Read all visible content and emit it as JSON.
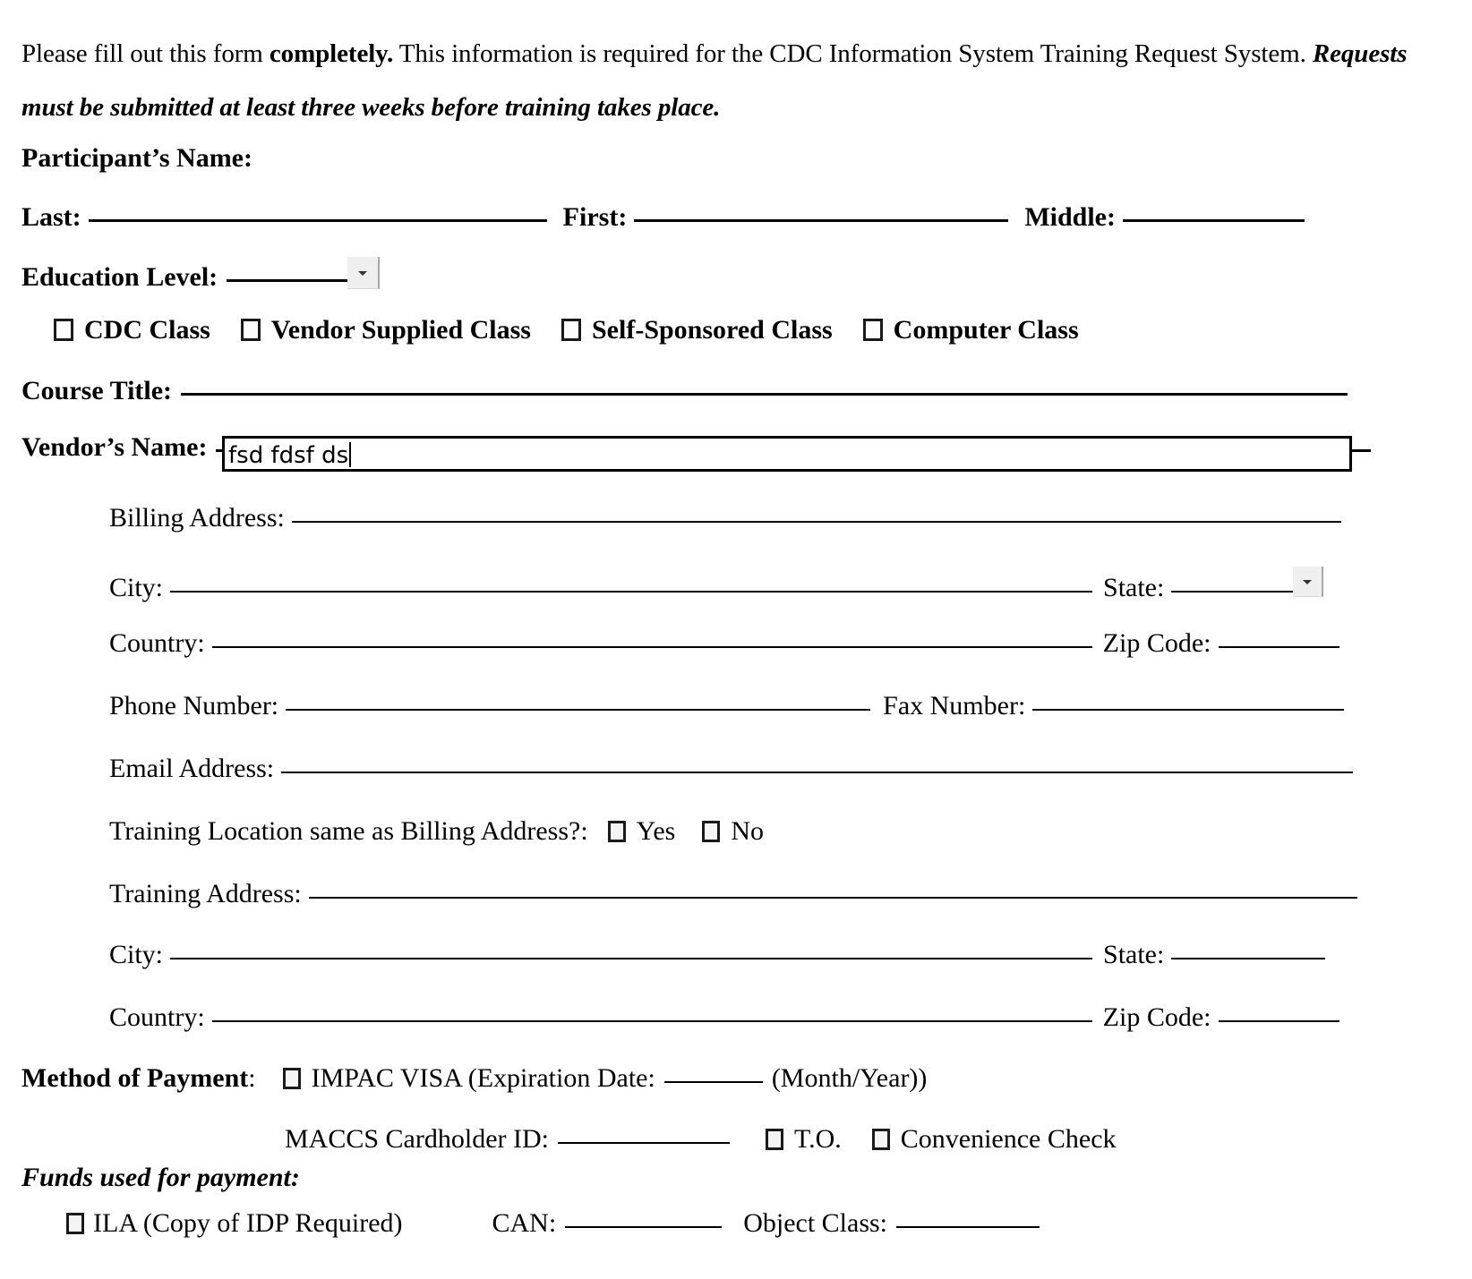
{
  "document": {
    "intro": {
      "part1": "Please fill out this form ",
      "bold1": "completely.",
      "part2": "  This information is required for the CDC Information System Training Request System.  ",
      "bolditalic": "Requests must be submitted at least three weeks before training takes place."
    },
    "participant_heading": "Participant’s Name:",
    "name_row": {
      "last_label": "Last:",
      "first_label": "First:",
      "middle_label": "Middle:"
    },
    "education": {
      "label": "Education Level:",
      "dropdown_icon": "chevron-down-icon"
    },
    "class_type_checkboxes": [
      {
        "label": "CDC Class",
        "checked": false
      },
      {
        "label": "Vendor Supplied Class",
        "checked": false
      },
      {
        "label": "Self-Sponsored Class",
        "checked": false
      },
      {
        "label": "Computer Class",
        "checked": false
      }
    ],
    "course_title_label": "Course Title:",
    "vendor_name": {
      "label": "Vendor’s Name:",
      "value": "fsd fdsf ds",
      "placeholder": ""
    },
    "billing": {
      "billing_address_label": "Billing Address:",
      "city_label": "City:",
      "state_label": "State:",
      "state_dropdown_icon": "chevron-down-icon",
      "country_label": "Country:",
      "zip_label": "Zip Code:",
      "phone_label": "Phone Number:",
      "fax_label": "Fax Number:",
      "email_label": "Email Address:"
    },
    "training_same_question": {
      "label": "Training Location same as Billing Address?:",
      "yes_label": "Yes",
      "no_label": "No",
      "yes_checked": false,
      "no_checked": false
    },
    "training": {
      "address_label": "Training Address:",
      "city_label": "City:",
      "state_label": "State:",
      "country_label": "Country:",
      "zip_label": "Zip Code:"
    },
    "payment": {
      "method_label": "Method of Payment",
      "method_colon": ":",
      "impac_checked": false,
      "impac_label_a": "IMPAC VISA (Expiration Date:",
      "impac_label_b": "(Month/Year))",
      "maccs_label": "MACCS Cardholder ID:",
      "to_label": "T.O.",
      "to_checked": false,
      "convenience_label": "Convenience Check",
      "convenience_checked": false
    },
    "funds": {
      "heading": "Funds used for payment:",
      "ila_label": "ILA (Copy of IDP Required)",
      "ila_checked": false,
      "can_label": "CAN:",
      "object_class_label": "Object Class:"
    }
  }
}
